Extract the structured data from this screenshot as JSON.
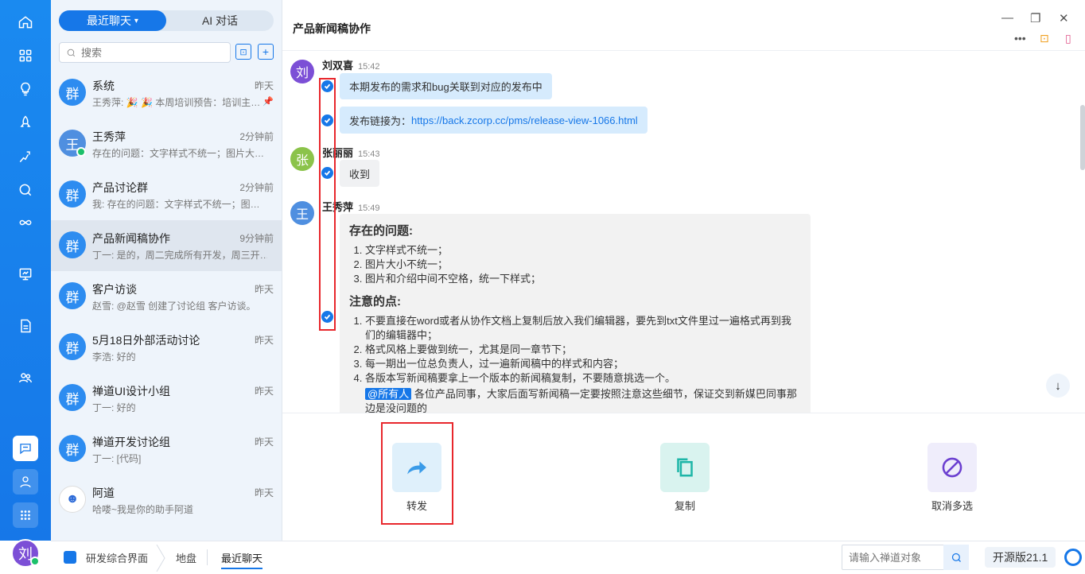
{
  "rail": {
    "icons": [
      "home-icon",
      "apps-icon",
      "bulb-icon",
      "rocket-icon",
      "run-icon",
      "search-icon",
      "infinity-icon",
      "board-icon",
      "doc-icon",
      "team-icon"
    ],
    "bottom": [
      "chat-icon",
      "user-icon",
      "grid-icon"
    ],
    "avatar": "刘"
  },
  "list": {
    "tabs": [
      "最近聊天",
      "AI 对话"
    ],
    "search_placeholder": "搜索",
    "items": [
      {
        "avatar": "群",
        "name": "系统",
        "time": "昨天",
        "msg": "王秀萍: 🎉 🎉 本周培训预告：培训主…"
      },
      {
        "avatar": "王",
        "name": "王秀萍",
        "time": "2分钟前",
        "msg": "存在的问题：文字样式不统一；图片大…"
      },
      {
        "avatar": "群",
        "name": "产品讨论群",
        "time": "2分钟前",
        "msg": "我: 存在的问题：文字样式不统一；图…"
      },
      {
        "avatar": "群",
        "name": "产品新闻稿协作",
        "time": "9分钟前",
        "msg": "丁一: 是的，周二完成所有开发，周三开…"
      },
      {
        "avatar": "群",
        "name": "客户访谈",
        "time": "昨天",
        "msg": "赵雪: @赵雪 创建了讨论组 客户访谈。"
      },
      {
        "avatar": "群",
        "name": "5月18日外部活动讨论",
        "time": "昨天",
        "msg": "李浩: 好的"
      },
      {
        "avatar": "群",
        "name": "禅道UI设计小组",
        "time": "昨天",
        "msg": "丁一: 好的"
      },
      {
        "avatar": "群",
        "name": "禅道开发讨论组",
        "time": "昨天",
        "msg": "丁一: [代码]"
      },
      {
        "avatar": "",
        "name": "阿道",
        "time": "昨天",
        "msg": "哈喽~我是你的助手阿道"
      }
    ]
  },
  "chat": {
    "title": "产品新闻稿协作",
    "messages": {
      "m1": {
        "avatar": "刘",
        "name": "刘双喜",
        "time": "15:42",
        "text1": "本期发布的需求和bug关联到对应的发布中",
        "text2_prefix": "发布链接为：",
        "text2_link": "https://back.zcorp.cc/pms/release-view-1066.html"
      },
      "m2": {
        "avatar": "张",
        "name": "张丽丽",
        "time": "15:43",
        "text": "收到"
      },
      "m3": {
        "avatar": "王",
        "name": "王秀萍",
        "time": "15:49",
        "h1": "存在的问题:",
        "list1": [
          "文字样式不统一；",
          "图片大小不统一；",
          "图片和介绍中间不空格，统一下样式；"
        ],
        "h2": "注意的点:",
        "list2": [
          "不要直接在word或者从协作文档上复制后放入我们编辑器，要先到txt文件里过一遍格式再到我们的编辑器中；",
          "格式风格上要做到统一，尤其是同一章节下；",
          "每一期出一位总负责人，过一遍新闻稿中的样式和内容；",
          "各版本写新闻稿要拿上一个版本的新闻稿复制，不要随意挑选一个。"
        ],
        "mention": "@所有人",
        "note": "各位产品同事，大家后面写新闻稿一定要按照注意这些细节，保证交到新媒巴同事那边是没问题的"
      }
    },
    "actions": {
      "forward": "转发",
      "copy": "复制",
      "cancel": "取消多选"
    }
  },
  "bottom": {
    "crumbs": [
      "研发综合界面",
      "地盘",
      "最近聊天"
    ],
    "search_placeholder": "请输入禅道对象",
    "version": "开源版21.1"
  },
  "colors": {
    "primary": "#1677e8",
    "red": "#e8272c",
    "teal": "#1fb6a8",
    "purple": "#6b3fd0"
  }
}
